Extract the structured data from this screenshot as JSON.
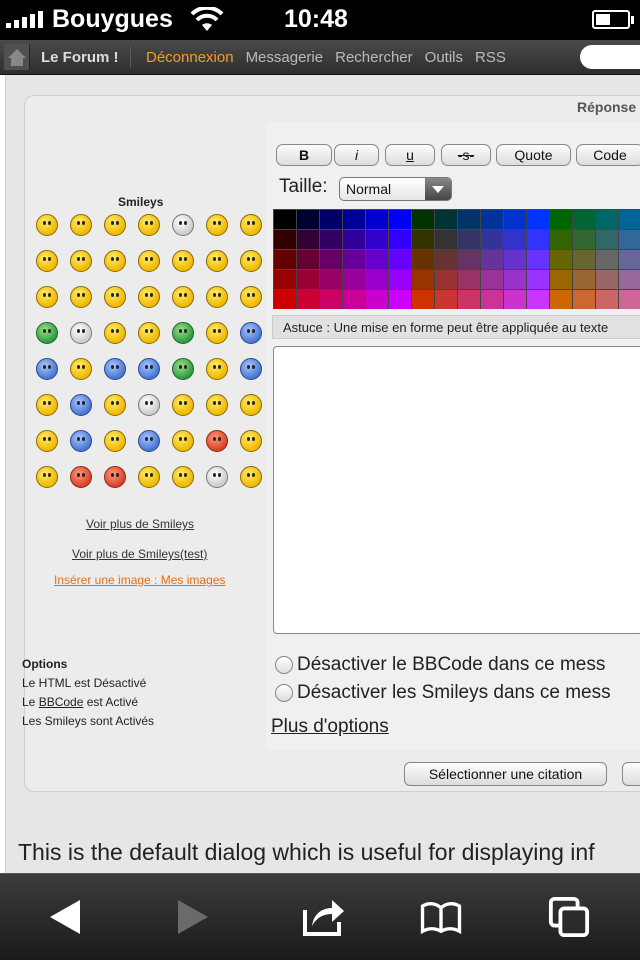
{
  "status_bar": {
    "carrier": "Bouygues",
    "time": "10:48"
  },
  "nav": {
    "title": "Le Forum !",
    "links": [
      "Déconnexion",
      "Messagerie",
      "Rechercher",
      "Outils",
      "RSS"
    ]
  },
  "reply_header": "Réponse",
  "smileys": {
    "heading": "Smileys",
    "items": [
      "grin",
      "smile",
      "worried",
      "surprised",
      "eyes",
      "confused",
      "cool",
      "laugh",
      "mad",
      "tongue",
      "sad",
      "frown",
      "devil",
      "devil-grin",
      "glasses",
      "wink",
      "exclamation",
      "question",
      "idea",
      "arrow",
      "neutral",
      "teeth",
      "ghost",
      "sunglasses",
      "happy",
      "green",
      "blush",
      "eyeroll",
      "blue",
      "sick",
      "blue-face",
      "alien",
      "puke",
      "smirk",
      "blue-sad",
      "yellow-grin",
      "bandana",
      "smug",
      "hmm",
      "thinking",
      "bald",
      "smug-2",
      "flower",
      "blue-sleep",
      "dizzy",
      "blue-angry",
      "flat",
      "red-angry",
      "pacman",
      "chicken",
      "cry",
      "angry-red",
      "pirate",
      "laughing",
      "sneeze",
      "sick-face"
    ],
    "more_link": "Voir plus de Smileys",
    "more_test_link": "Voir plus de Smileys(test)",
    "insert_image_link": "Insérer une image : Mes images"
  },
  "options": {
    "heading": "Options",
    "html_status": "Le HTML est Désactivé",
    "bbcode_prefix": "Le",
    "bbcode_link": "BBCode",
    "bbcode_suffix": "est Activé",
    "smileys_status": "Les Smileys sont Activés"
  },
  "editor": {
    "buttons": [
      "B",
      "i",
      "u",
      "-s-",
      "Quote",
      "Code"
    ],
    "size_label": "Taille:",
    "size_value": "Normal",
    "hint": "Astuce : Une mise en forme peut être appliquée au texte",
    "disable_bbcode": "Désactiver le BBCode dans ce mess",
    "disable_smileys": "Désactiver les Smileys dans ce mess",
    "more_options": "Plus d'options",
    "select_quote": "Sélectionner une citation"
  },
  "palette_colors": [
    [
      "#000000",
      "#000033",
      "#000066",
      "#000099",
      "#0000cc",
      "#0000ff",
      "#003300",
      "#003333",
      "#003366",
      "#003399",
      "#0033cc",
      "#0033ff",
      "#006600",
      "#006633",
      "#006666",
      "#006699",
      "#00cc00"
    ],
    [
      "#330000",
      "#330033",
      "#330066",
      "#330099",
      "#3300cc",
      "#3300ff",
      "#333300",
      "#333333",
      "#333366",
      "#333399",
      "#3333cc",
      "#3333ff",
      "#336600",
      "#336633",
      "#336666",
      "#336699",
      "#33cc00"
    ],
    [
      "#660000",
      "#660033",
      "#660066",
      "#660099",
      "#6600cc",
      "#6600ff",
      "#663300",
      "#663333",
      "#663366",
      "#663399",
      "#6633cc",
      "#6633ff",
      "#666600",
      "#666633",
      "#666666",
      "#666699",
      "#66cc00"
    ],
    [
      "#990000",
      "#990033",
      "#990066",
      "#990099",
      "#9900cc",
      "#9900ff",
      "#993300",
      "#993333",
      "#993366",
      "#993399",
      "#9933cc",
      "#9933ff",
      "#996600",
      "#996633",
      "#996666",
      "#996699",
      "#99cc00"
    ],
    [
      "#cc0000",
      "#cc0033",
      "#cc0066",
      "#cc0099",
      "#cc00cc",
      "#cc00ff",
      "#cc3300",
      "#cc3333",
      "#cc3366",
      "#cc3399",
      "#cc33cc",
      "#cc33ff",
      "#cc6600",
      "#cc6633",
      "#cc6666",
      "#cc6699",
      "#cccc00"
    ]
  ],
  "footer_text": "This is the default dialog which is useful for displaying inf",
  "toolbar": [
    "back-icon",
    "forward-icon",
    "share-icon",
    "bookmarks-icon",
    "tabs-icon"
  ]
}
